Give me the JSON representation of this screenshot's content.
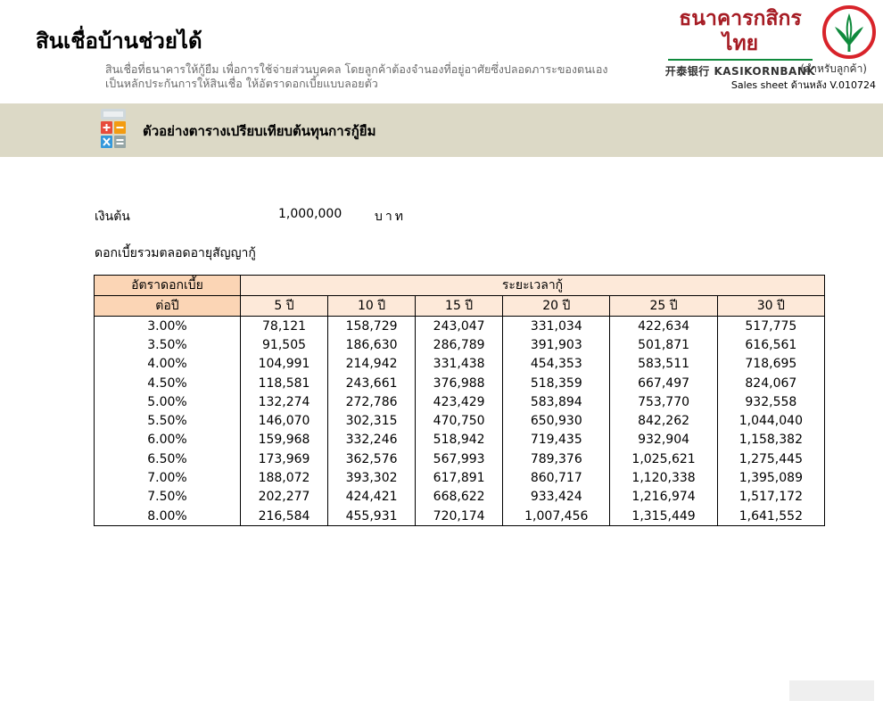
{
  "header": {
    "title": "สินเชื่อบ้านช่วยได้",
    "description_line1": "สินเชื่อที่ธนาคารให้กู้ยืม เพื่อการใช้จ่ายส่วนบุคคล โดยลูกค้าต้องจำนองที่อยู่อาศัยซึ่งปลอดภาระของตนเอง",
    "description_line2": "เป็นหลักประกันการให้สินเชื่อ ให้อัตราดอกเบี้ยแบบลอยตัว",
    "bank_name_th": "ธนาคารกสิกรไทย",
    "bank_name_en": "开泰银行 KASIKORNBANK",
    "for_customer": "(สำหรับลูกค้า)",
    "sheet_version": "Sales sheet ด้านหลัง V.010724"
  },
  "section": {
    "title": "ตัวอย่างตารางเปรียบเทียบต้นทุนการกู้ยืม"
  },
  "principal": {
    "label": "เงินต้น",
    "value": "1,000,000",
    "unit": "บาท"
  },
  "interest_caption": "ดอกเบี้ยรวมตลอดอายุสัญญากู้",
  "table": {
    "rate_header_line1": "อัตราดอกเบี้ย",
    "rate_header_line2": "ต่อปี",
    "period_header": "ระยะเวลากู้",
    "periods": [
      "5 ปี",
      "10 ปี",
      "15 ปี",
      "20 ปี",
      "25 ปี",
      "30 ปี"
    ],
    "rows": [
      {
        "rate": "3.00%",
        "values": [
          "78,121",
          "158,729",
          "243,047",
          "331,034",
          "422,634",
          "517,775"
        ]
      },
      {
        "rate": "3.50%",
        "values": [
          "91,505",
          "186,630",
          "286,789",
          "391,903",
          "501,871",
          "616,561"
        ]
      },
      {
        "rate": "4.00%",
        "values": [
          "104,991",
          "214,942",
          "331,438",
          "454,353",
          "583,511",
          "718,695"
        ]
      },
      {
        "rate": "4.50%",
        "values": [
          "118,581",
          "243,661",
          "376,988",
          "518,359",
          "667,497",
          "824,067"
        ]
      },
      {
        "rate": "5.00%",
        "values": [
          "132,274",
          "272,786",
          "423,429",
          "583,894",
          "753,770",
          "932,558"
        ]
      },
      {
        "rate": "5.50%",
        "values": [
          "146,070",
          "302,315",
          "470,750",
          "650,930",
          "842,262",
          "1,044,040"
        ]
      },
      {
        "rate": "6.00%",
        "values": [
          "159,968",
          "332,246",
          "518,942",
          "719,435",
          "932,904",
          "1,158,382"
        ]
      },
      {
        "rate": "6.50%",
        "values": [
          "173,969",
          "362,576",
          "567,993",
          "789,376",
          "1,025,621",
          "1,275,445"
        ]
      },
      {
        "rate": "7.00%",
        "values": [
          "188,072",
          "393,302",
          "617,891",
          "860,717",
          "1,120,338",
          "1,395,089"
        ]
      },
      {
        "rate": "7.50%",
        "values": [
          "202,277",
          "424,421",
          "668,622",
          "933,424",
          "1,216,974",
          "1,517,172"
        ]
      },
      {
        "rate": "8.00%",
        "values": [
          "216,584",
          "455,931",
          "720,174",
          "1,007,456",
          "1,315,449",
          "1,641,552"
        ]
      }
    ]
  },
  "icons": {
    "calculator": "calculator-icon",
    "bank_logo": "kasikornbank-logo-icon"
  },
  "colors": {
    "brand_green": "#0f8a3c",
    "brand_red": "#a61c24",
    "band_background": "#dcd9c6",
    "table_header": "#fde9d9",
    "rate_header": "#fbd5b5"
  }
}
